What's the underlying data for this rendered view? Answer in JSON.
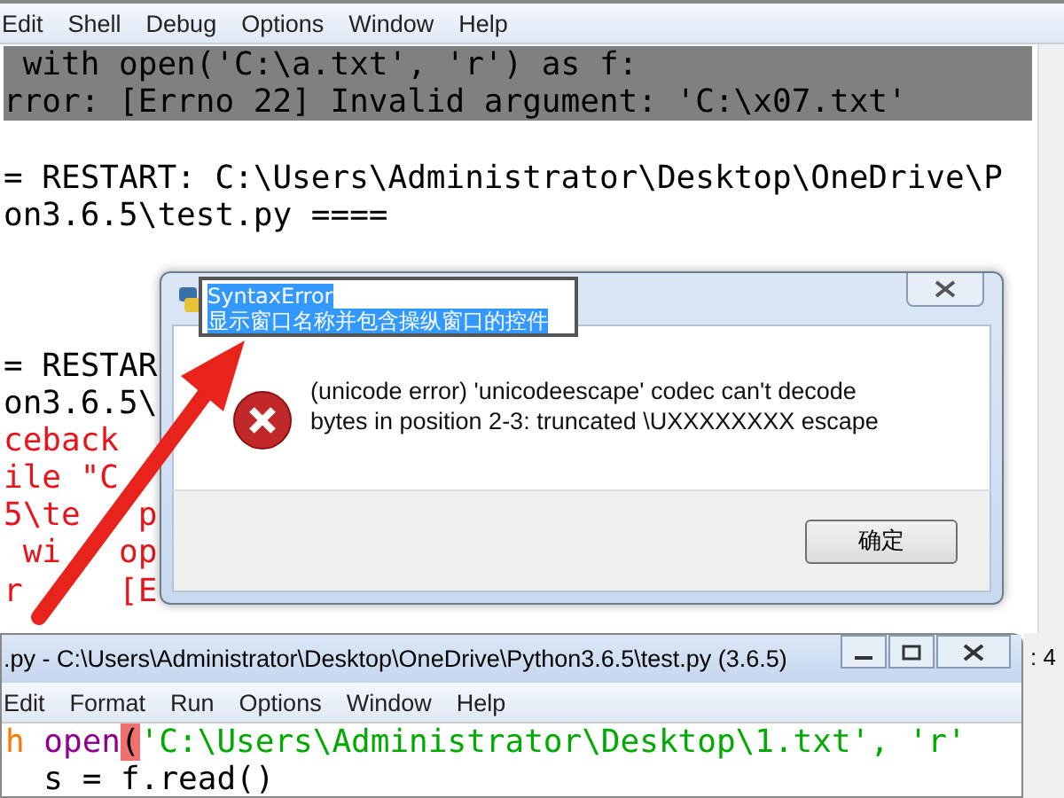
{
  "shell": {
    "menu": [
      "Edit",
      "Shell",
      "Debug",
      "Options",
      "Window",
      "Help"
    ],
    "lines": [
      {
        "text": " with open('C:\\a.txt', 'r') as f:",
        "kind": "selected"
      },
      {
        "text": "rror: [Errno 22] Invalid argument: 'C:\\x07.txt'",
        "kind": "selected"
      },
      {
        "kind": "blank"
      },
      {
        "text": "= RESTART: C:\\Users\\Administrator\\Desktop\\OneDrive\\P",
        "kind": "normal"
      },
      {
        "text": "on3.6.5\\test.py ====",
        "kind": "normal"
      },
      {
        "kind": "blank"
      },
      {
        "kind": "blank"
      },
      {
        "kind": "blank"
      },
      {
        "text": "= RESTAR",
        "kind": "normal"
      },
      {
        "text": "on3.6.5\\",
        "kind": "normal"
      },
      {
        "text": "ceback",
        "kind": "error"
      },
      {
        "text": "ile \"C",
        "kind": "error"
      },
      {
        "text": "5\\te   p",
        "kind": "error"
      },
      {
        "text": " wi   op",
        "kind": "error"
      },
      {
        "text": "r     [E",
        "kind": "error"
      }
    ],
    "status": ": 4"
  },
  "dialog": {
    "title_field": {
      "lines": [
        "SyntaxError",
        "显示窗口名称并包含操纵窗口的控件"
      ],
      "selected": true
    },
    "message": "(unicode error) 'unicodeescape' codec can't decode bytes in position 2-3: truncated \\UXXXXXXXX escape",
    "button": "确定"
  },
  "editor": {
    "title": ".py - C:\\Users\\Administrator\\Desktop\\OneDrive\\Python3.6.5\\test.py (3.6.5)",
    "menu": [
      "Edit",
      "Format",
      "Run",
      "Options",
      "Window",
      "Help"
    ],
    "lines": [
      [
        {
          "text": "h",
          "kind": "keyword"
        },
        {
          "text": "open",
          "kind": "builtin"
        },
        {
          "text": "(",
          "kind": "match"
        },
        {
          "text": "'C:\\Users\\Administrator\\Desktop\\1.txt', 'r'",
          "kind": "string"
        }
      ],
      [
        {
          "text": "  s = f.read()",
          "kind": "plain"
        }
      ]
    ]
  }
}
